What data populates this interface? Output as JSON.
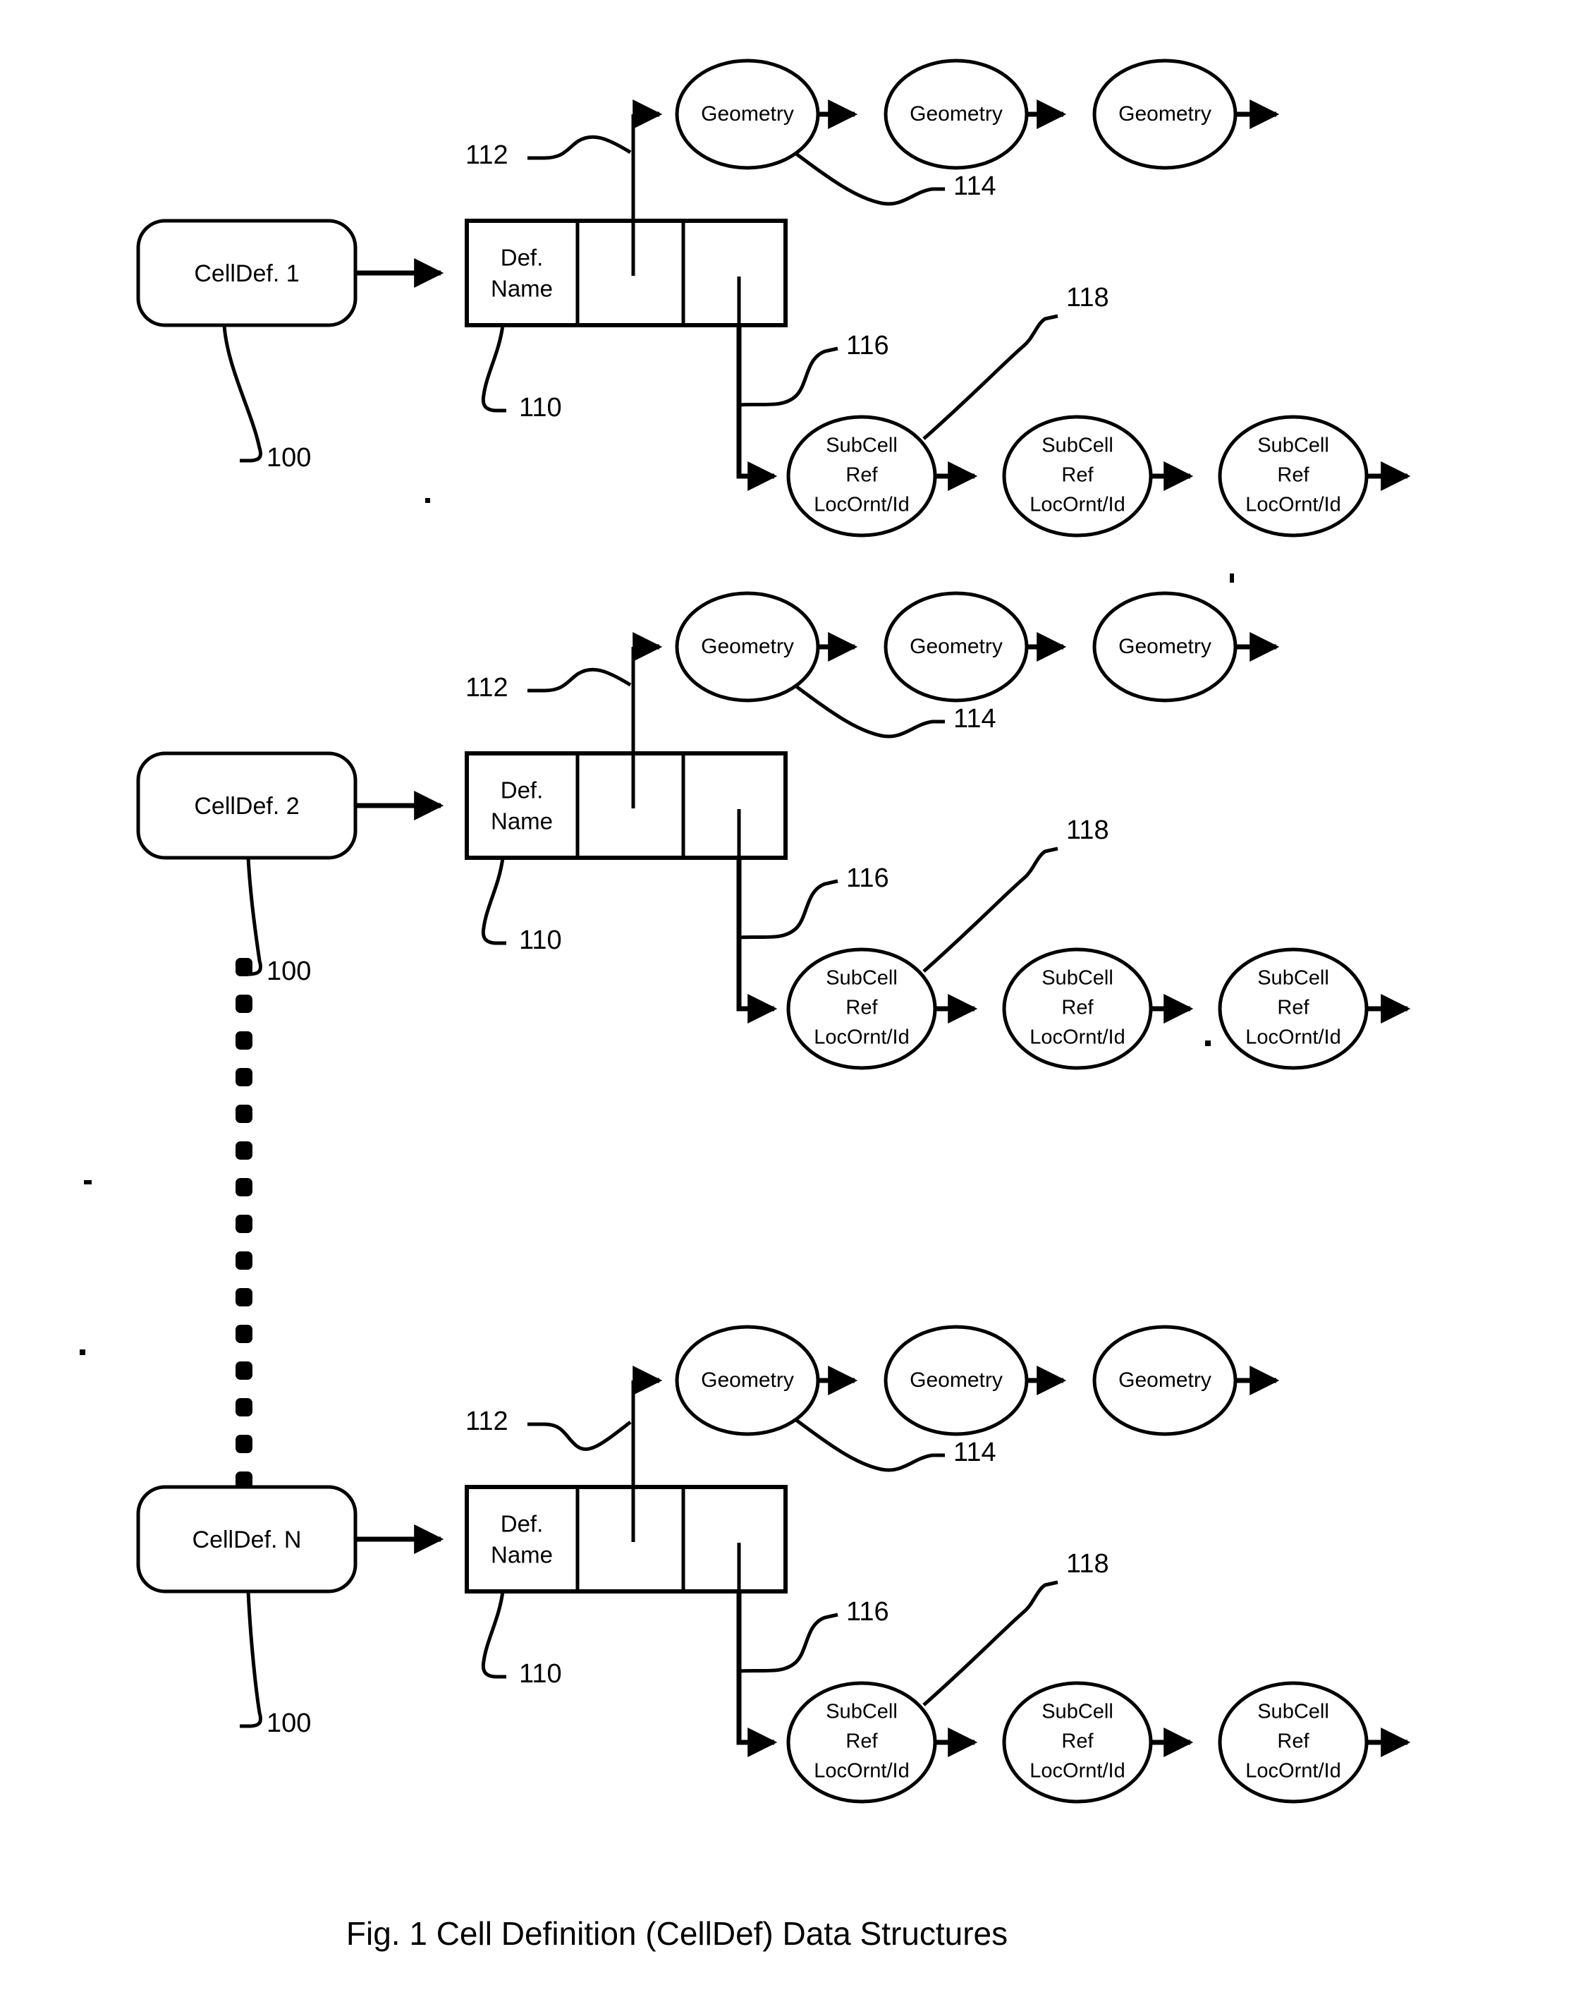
{
  "figure": {
    "caption": "Fig. 1   Cell Definition (CellDef) Data Structures",
    "caption_number": "Fig. 1",
    "caption_title": "Cell Definition (CellDef) Data Structures"
  },
  "labels": {
    "def_name_line1": "Def.",
    "def_name_line2": "Name",
    "geometry": "Geometry",
    "subcell_line1": "SubCell",
    "subcell_line2": "Ref",
    "subcell_line3": "LocOrnt/Id"
  },
  "reference_numerals": {
    "celldef": "100",
    "defname_record": "110",
    "geometry_pointer": "112",
    "geometry_node": "114",
    "subcell_pointer": "116",
    "subcell_node": "118"
  },
  "groups": [
    {
      "id": "group-1",
      "celldef_label": "CellDef. 1",
      "ref_celldef": "100",
      "ref_record": "110",
      "ref_geom_ptr": "112",
      "ref_geom_node": "114",
      "ref_sub_ptr": "116",
      "ref_sub_node": "118",
      "geometry_nodes": [
        "Geometry",
        "Geometry",
        "Geometry"
      ],
      "subcell_nodes": [
        [
          "SubCell",
          "Ref",
          "LocOrnt/Id"
        ],
        [
          "SubCell",
          "Ref",
          "LocOrnt/Id"
        ],
        [
          "SubCell",
          "Ref",
          "LocOrnt/Id"
        ]
      ],
      "record_cells": [
        "Def.\nName",
        "",
        ""
      ]
    },
    {
      "id": "group-2",
      "celldef_label": "CellDef. 2",
      "ref_celldef": "100",
      "ref_record": "110",
      "ref_geom_ptr": "112",
      "ref_geom_node": "114",
      "ref_sub_ptr": "116",
      "ref_sub_node": "118",
      "geometry_nodes": [
        "Geometry",
        "Geometry",
        "Geometry"
      ],
      "subcell_nodes": [
        [
          "SubCell",
          "Ref",
          "LocOrnt/Id"
        ],
        [
          "SubCell",
          "Ref",
          "LocOrnt/Id"
        ],
        [
          "SubCell",
          "Ref",
          "LocOrnt/Id"
        ]
      ],
      "record_cells": [
        "Def.\nName",
        "",
        ""
      ]
    },
    {
      "id": "group-3",
      "celldef_label": "CellDef. N",
      "ref_celldef": "100",
      "ref_record": "110",
      "ref_geom_ptr": "112",
      "ref_geom_node": "114",
      "ref_sub_ptr": "116",
      "ref_sub_node": "118",
      "geometry_nodes": [
        "Geometry",
        "Geometry",
        "Geometry"
      ],
      "subcell_nodes": [
        [
          "SubCell",
          "Ref",
          "LocOrnt/Id"
        ],
        [
          "SubCell",
          "Ref",
          "LocOrnt/Id"
        ],
        [
          "SubCell",
          "Ref",
          "LocOrnt/Id"
        ]
      ],
      "record_cells": [
        "Def.\nName",
        "",
        ""
      ]
    }
  ],
  "ellipsis": {
    "style": "vertical-dotted-line",
    "dot_count": 15
  },
  "colors": {
    "ink": "#000000",
    "paper": "#ffffff"
  }
}
